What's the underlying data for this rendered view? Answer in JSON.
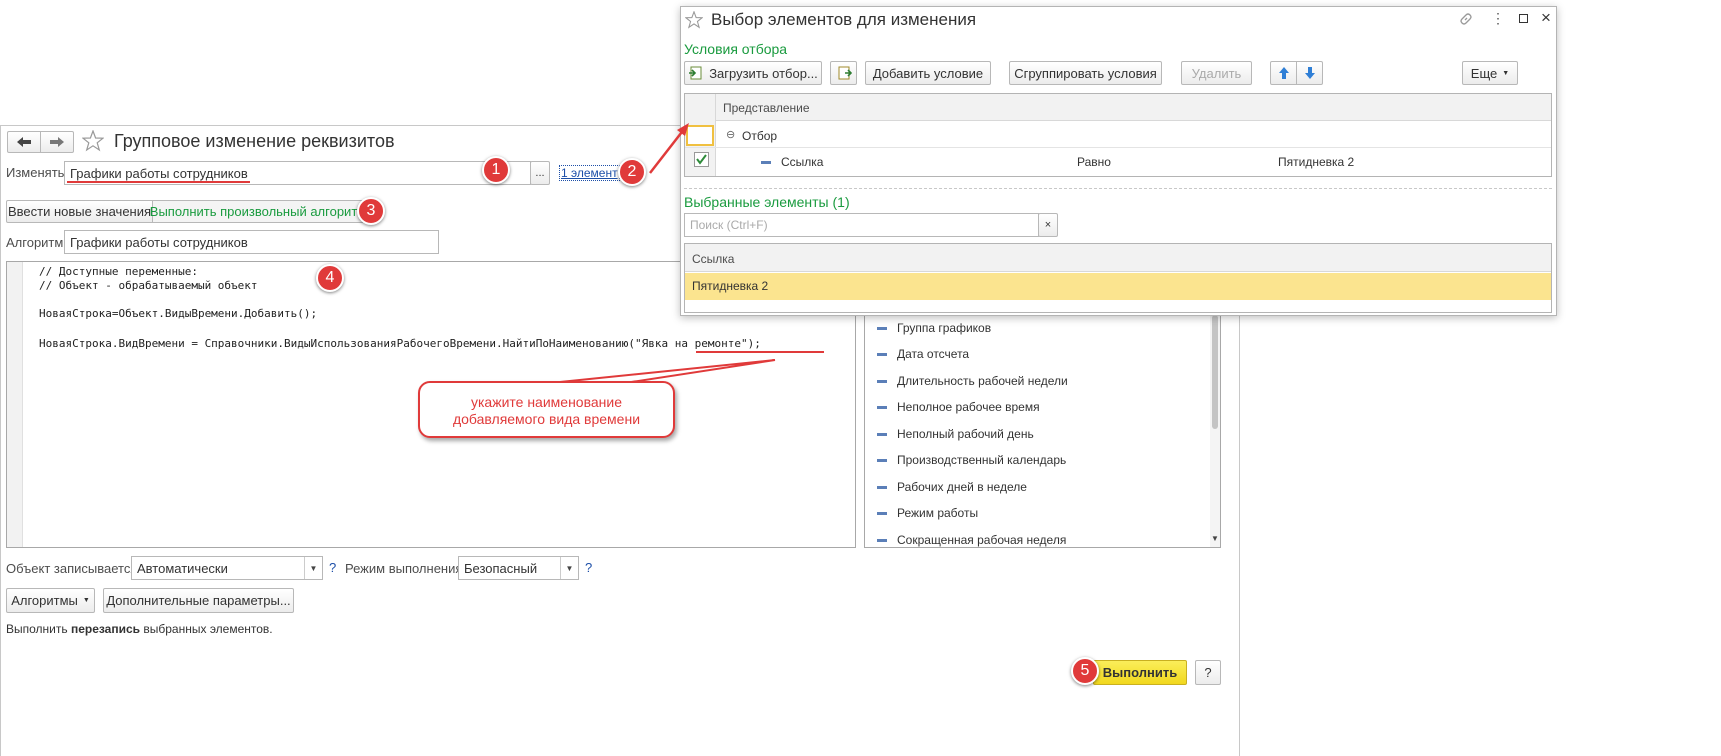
{
  "main_window": {
    "title": "Групповое изменение реквизитов",
    "change_label": "Изменять:",
    "change_value": "Графики работы сотрудников",
    "elements_link": "1 элемент",
    "tabs": [
      "Ввести новые значения",
      "Выполнить произвольный алгоритм"
    ],
    "algorithm_label": "Алгоритм:",
    "algorithm_value": "Графики работы сотрудников",
    "code_lines": [
      "// Доступные переменные:",
      "// Объект - обрабатываемый объект",
      "",
      "НоваяСтрока=Объект.ВидыВремени.Добавить();",
      "",
      "НоваяСтрока.ВидВремени = Справочники.ВидыИспользованияРабочегоВремени.НайтиПоНаименованию(\"Явка на ремонте\");"
    ],
    "callout": "укажите наименование\nдобавляемого вида времени",
    "fields": [
      "Группа графиков",
      "Дата отсчета",
      "Длительность рабочей недели",
      "Неполное рабочее время",
      "Неполный рабочий день",
      "Производственный календарь",
      "Рабочих дней в неделе",
      "Режим работы",
      "Сокращенная рабочая неделя"
    ],
    "write_label": "Объект записывается:",
    "write_value": "Автоматически",
    "mode_label": "Режим выполнения:",
    "mode_value": "Безопасный",
    "help_char": "?",
    "algorithms_button": "Алгоритмы",
    "extra_params_button": "Дополнительные параметры...",
    "status_prefix": "Выполнить ",
    "status_bold": "перезапись",
    "status_suffix": " выбранных элементов.",
    "execute_button": "Выполнить",
    "help_button": "?"
  },
  "dialog": {
    "title": "Выбор элементов для изменения",
    "filter_section": "Условия отбора",
    "load_filter_button": "Загрузить отбор...",
    "add_condition_button": "Добавить условие",
    "group_conditions_button": "Сгруппировать условия",
    "delete_button": "Удалить",
    "more_button": "Еще",
    "filter_header": "Представление",
    "filter_group": "Отбор",
    "filter_row": {
      "field": "Ссылка",
      "comparison": "Равно",
      "value": "Пятидневка 2"
    },
    "selected_section": "Выбранные элементы (1)",
    "search_placeholder": "Поиск (Ctrl+F)",
    "list_header": "Ссылка",
    "list_items": [
      "Пятидневка 2"
    ]
  },
  "badges": [
    "1",
    "2",
    "3",
    "4",
    "5"
  ],
  "colors": {
    "accent_green": "#1a9b3f",
    "badge_red": "#e03a3a",
    "highlight_yellow": "#fbe48f",
    "execute_yellow": "#f7e432"
  }
}
